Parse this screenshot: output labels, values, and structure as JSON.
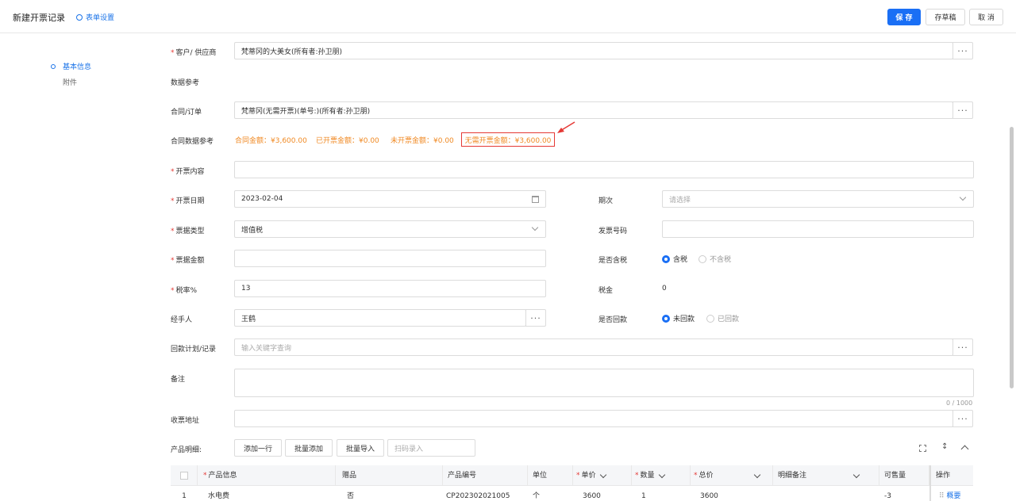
{
  "header": {
    "title": "新建开票记录",
    "form_settings": "表单设置",
    "save": "保 存",
    "draft": "存草稿",
    "cancel": "取 消"
  },
  "nav": {
    "items": [
      {
        "label": "基本信息",
        "active": true
      },
      {
        "label": "附件",
        "active": false
      }
    ]
  },
  "form": {
    "customer": {
      "label": "客户/ 供应商",
      "value": "梵蒂冈的大美女(所有者:孙卫朋)"
    },
    "data_ref_label": "数据参考",
    "contract": {
      "label": "合同/订单",
      "value": "梵蒂冈(无需开票)(单号:)(所有者:孙卫朋)"
    },
    "contract_ref": {
      "label": "合同数据参考",
      "amount": "合同金额：¥3,600.00",
      "invoiced": "已开票金额：¥0.00",
      "uninvoiced": "未开票金额：¥0.00",
      "no_invoice": "无需开票金额：¥3,600.00"
    },
    "content": {
      "label": "开票内容",
      "value": ""
    },
    "date": {
      "label": "开票日期",
      "value": "2023-02-04"
    },
    "period": {
      "label": "期次",
      "placeholder": "请选择"
    },
    "ticket_type": {
      "label": "票据类型",
      "value": "增值税"
    },
    "invoice_no": {
      "label": "发票号码",
      "value": ""
    },
    "ticket_amount": {
      "label": "票据金额",
      "value": ""
    },
    "tax_incl": {
      "label": "是否含税",
      "opt1": "含税",
      "opt2": "不含税"
    },
    "tax_rate": {
      "label": "税率%",
      "value": "13"
    },
    "tax": {
      "label": "税金",
      "value": "0"
    },
    "handler": {
      "label": "经手人",
      "value": "王鹤"
    },
    "returned": {
      "label": "是否回款",
      "opt1": "未回款",
      "opt2": "已回款"
    },
    "payment_plan": {
      "label": "回款计划/记录",
      "placeholder": "输入关键字查询"
    },
    "remark": {
      "label": "备注",
      "counter": "0 / 1000"
    },
    "address": {
      "label": "收票地址",
      "value": ""
    }
  },
  "products": {
    "label": "产品明细:",
    "add_row": "添加一行",
    "batch_add": "批量添加",
    "batch_import": "批量导入",
    "scan_placeholder": "扫码录入",
    "columns": [
      "产品信息",
      "赠品",
      "产品编号",
      "单位",
      "单价",
      "数量",
      "总价",
      "明细备注",
      "可售量",
      "操作"
    ],
    "rows": [
      {
        "index": "1",
        "name": "水电费",
        "gift": "否",
        "code": "CP202302021005",
        "unit": "个",
        "price": "3600",
        "qty": "1",
        "total": "3600",
        "note": "",
        "available": "-3",
        "action": "概要"
      }
    ]
  },
  "colors": {
    "primary": "#1a6ff5",
    "orange": "#f08a24",
    "red": "#e53935"
  }
}
